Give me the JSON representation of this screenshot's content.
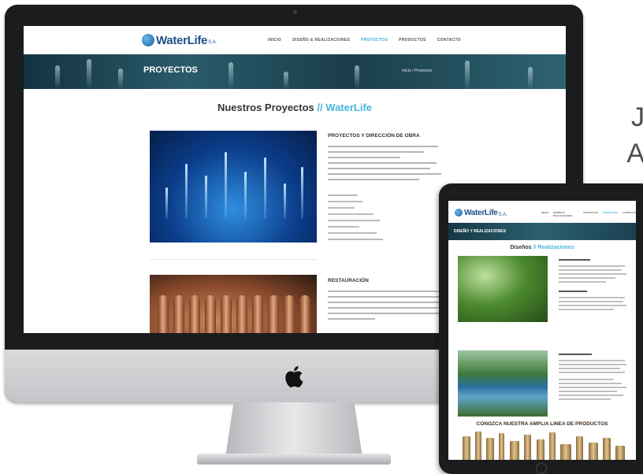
{
  "side_text": [
    "J",
    "A"
  ],
  "desktop_site": {
    "logo": {
      "name": "WaterLife",
      "suffix": "S.A."
    },
    "nav": [
      {
        "label": "INICIO",
        "active": false
      },
      {
        "label": "DISEÑO & REALIZACIONES",
        "active": false
      },
      {
        "label": "PROYECTOS",
        "active": true
      },
      {
        "label": "PRODUCTOS",
        "active": false
      },
      {
        "label": "CONTACTO",
        "active": false
      }
    ],
    "banner_title": "PROYECTOS",
    "breadcrumb": "Inicio / Proyectos",
    "section_title": "Nuestros Proyectos",
    "section_separator": "//",
    "section_accent": "WaterLife",
    "projects": [
      {
        "heading": "PROYECTOS Y DIRECCIÓN DE OBRA"
      },
      {
        "heading": "RESTAURACIÓN"
      }
    ]
  },
  "tablet_site": {
    "logo": {
      "name": "WaterLife",
      "suffix": "S.A."
    },
    "nav": [
      {
        "label": "INICIO",
        "active": false
      },
      {
        "label": "DISEÑO & REALIZACIONES",
        "active": false
      },
      {
        "label": "PROYECTOS",
        "active": false
      },
      {
        "label": "PRODUCTOS",
        "active": true
      },
      {
        "label": "CONTACTO",
        "active": false
      }
    ],
    "banner_title": "DISEÑO Y REALIZACIONES",
    "section_title": "Diseños",
    "section_separator": "//",
    "section_accent": "Realizaciones",
    "products_banner": "CONOZCA NUESTRA AMPLIA LINEA DE PRODUCTOS"
  },
  "colors": {
    "accent": "#45b6dc",
    "brand": "#1f4f8a",
    "bezel": "#1b1c1e"
  }
}
